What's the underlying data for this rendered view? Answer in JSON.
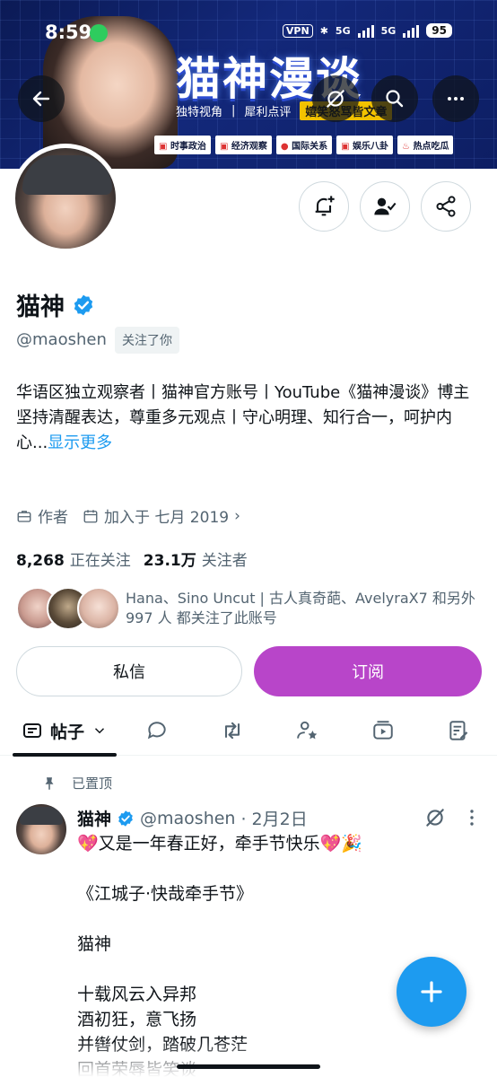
{
  "status_bar": {
    "time": "8:59",
    "vpn": "VPN",
    "net1": "5G",
    "net2": "5G",
    "battery": "95"
  },
  "banner": {
    "title": "猫神漫谈",
    "tagline_1": "独特视角",
    "tagline_2": "犀利点评",
    "tagline_highlight": "嬉笑怒骂皆文章",
    "tags": [
      "时事政治",
      "经济观察",
      "国际关系",
      "娱乐八卦",
      "热点吃瓜"
    ]
  },
  "profile": {
    "display_name": "猫神",
    "handle": "@maoshen",
    "follows_you": "关注了你",
    "bio_line1": "华语区独立观察者丨猫神官方账号丨YouTube《猫神漫谈》博主",
    "bio_line2": "坚持清醒表达，尊重多元观点丨守心明理、知行合一，呵护内心...",
    "show_more": "显示更多",
    "meta_author": "作者",
    "meta_joined": "加入于 七月 2019",
    "following_count": "8,268",
    "following_label": "正在关注",
    "followers_count": "23.1万",
    "followers_label": "关注者",
    "followed_by": "Hana、Sino Uncut | 古人真奇葩、AvelyraX7 和另外 997 人 都关注了此账号",
    "dm_button": "私信",
    "subscribe_button": "订阅"
  },
  "tabs": {
    "posts": "帖子"
  },
  "post": {
    "pinned_label": "已置顶",
    "author": "猫神",
    "handle": "@maoshen",
    "date": "· 2月2日",
    "body": "💖又是一年春正好，牵手节快乐💖🎉\n\n《江城子·快哉牵手节》\n\n猫神\n\n十载风云入异邦\n酒初狂，意飞扬\n并辔仗剑，踏破几苍茫\n回首荣辱皆笑谈"
  },
  "colors": {
    "accent": "#1d9bf0",
    "subscribe": "#b845c9",
    "text_secondary": "#536471"
  }
}
